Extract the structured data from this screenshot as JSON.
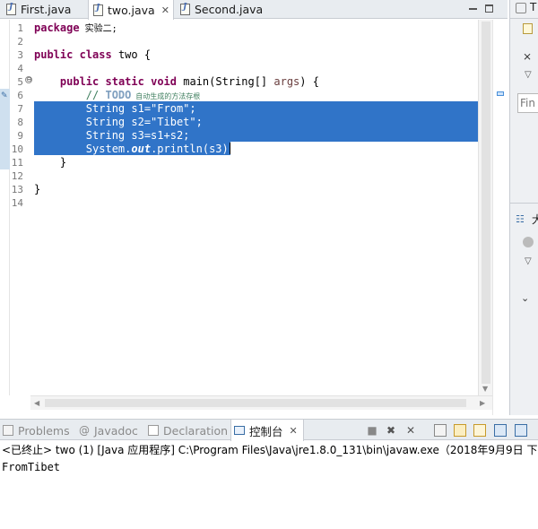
{
  "editor_tabs": [
    {
      "label": "First.java",
      "active": false
    },
    {
      "label": "two.java",
      "active": true
    },
    {
      "label": "Second.java",
      "active": false
    }
  ],
  "right_panel": {
    "top_letter": "T",
    "search_placeholder": "Fin",
    "mid_letter": "大"
  },
  "editor": {
    "line_numbers": [
      "1",
      "2",
      "3",
      "4",
      "5",
      "6",
      "7",
      "8",
      "9",
      "10",
      "11",
      "12",
      "13",
      "14"
    ],
    "fold_symbol": "⊖",
    "lines": {
      "l1_kw": "package",
      "l1_name": " 实验二;",
      "l3_kw1": "public",
      "l3_kw2": "class",
      "l3_name": " two {",
      "l5_indent": "    ",
      "l5_kw1": "public",
      "l5_kw2": "static",
      "l5_kw3": "void",
      "l5_sig": " main(String[] ",
      "l5_param": "args",
      "l5_end": ") {",
      "l6_comment": "        // ",
      "l6_todo": "TODO",
      "l6_text": " 自动生成的方法存根",
      "l7": "        String s1=\"From\";",
      "l8": "        String s2=\"Tibet\";",
      "l9": "        String s3=s1+s2;",
      "l10_a": "        System.",
      "l10_b": "out",
      "l10_c": ".println(s3);",
      "l11": "    }",
      "l13": "}"
    }
  },
  "bottom_tabs": {
    "problems": "Problems",
    "javadoc": "Javadoc",
    "declaration": "Declaration",
    "console": "控制台"
  },
  "console": {
    "header": "<已终止> two (1) [Java 应用程序] C:\\Program Files\\Java\\jre1.8.0_131\\bin\\javaw.exe（2018年9月9日 下午",
    "output": "FromTibet"
  },
  "colors": {
    "selection": "#3074c8",
    "keyword": "#7f0055",
    "comment": "#3f7f5f",
    "tab_bar": "#e8ecf0"
  }
}
